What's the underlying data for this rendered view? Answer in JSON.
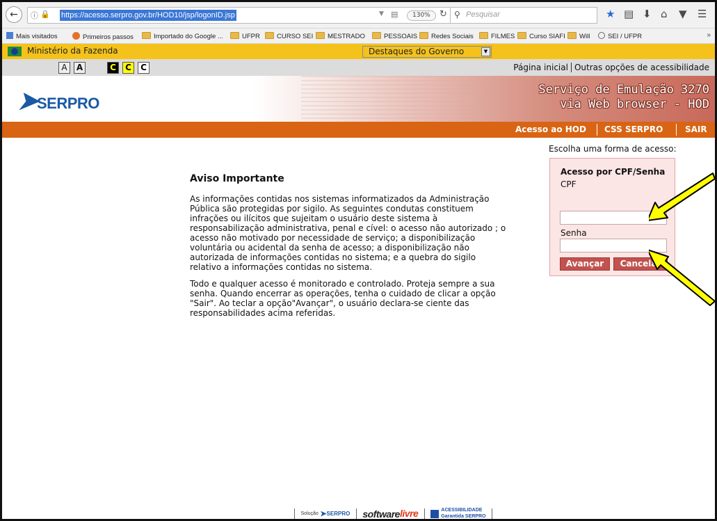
{
  "browser": {
    "url": "https://acesso.serpro.gov.br/HOD10/jsp/logonID.jsp",
    "zoom": "130%",
    "search_placeholder": "Pesquisar"
  },
  "bookmarks": [
    {
      "label": "Mais visitados",
      "icon": "mais-visitados-icon"
    },
    {
      "label": "Primeiros passos",
      "icon": "firefox-icon"
    },
    {
      "label": "Importado do Google ...",
      "icon": "folder-icon"
    },
    {
      "label": "UFPR",
      "icon": "folder-icon"
    },
    {
      "label": "CURSO SEI",
      "icon": "folder-icon"
    },
    {
      "label": "MESTRADO",
      "icon": "folder-icon"
    },
    {
      "label": "PESSOAIS",
      "icon": "folder-icon"
    },
    {
      "label": "Redes Sociais",
      "icon": "folder-icon"
    },
    {
      "label": "FILMES",
      "icon": "folder-icon"
    },
    {
      "label": "Curso SIAFI",
      "icon": "folder-icon"
    },
    {
      "label": "Will",
      "icon": "folder-icon"
    },
    {
      "label": "SEI / UFPR",
      "icon": "globe-icon"
    }
  ],
  "gov_bar": {
    "ministry": "Ministério da Fazenda",
    "select_value": "Destaques do Governo"
  },
  "accessibility": {
    "font_buttons": [
      "A",
      "A"
    ],
    "contrast_buttons": [
      "C",
      "C",
      "C"
    ],
    "home_link": "Página inicial",
    "other_options": "Outras opções de acessibilidade"
  },
  "header": {
    "logo_text": "SERPRO",
    "title_line1": "Serviço de Emulação 3270",
    "title_line2": "via Web browser - HOD"
  },
  "nav": {
    "hod": "Acesso ao HOD",
    "css": "CSS SERPRO",
    "exit": "SAIR"
  },
  "notice": {
    "title": "Aviso Importante",
    "paragraph1": "As informações contidas nos sistemas informatizados da Administração Pública são protegidas por sigilo. As seguintes condutas constituem infrações ou ilícitos que sujeitam o usuário deste sistema à responsabilização administrativa, penal e cível: o acesso não autorizado ; o acesso não motivado por necessidade de serviço; a disponibilização voluntária ou acidental da senha de acesso; a disponibilização não autorizada de informações contidas no sistema; e a quebra do sigilo relativo a informações contidas no sistema.",
    "paragraph2": "Todo e qualquer acesso é monitorado e controlado. Proteja sempre a sua senha. Quando encerrar as operações, tenha o cuidado de clicar a opção \"Sair\". Ao teclar a opção\"Avançar\", o usuário declara-se ciente das responsabilidades acima referidas."
  },
  "login": {
    "prompt": "Escolha uma forma de acesso:",
    "box_title": "Acesso por CPF/Senha",
    "cpf_label": "CPF",
    "cpf_value": "",
    "password_label": "Senha",
    "password_value": "",
    "submit": "Avançar",
    "cancel": "Cancelar"
  },
  "footer": {
    "solution_prefix": "Solução",
    "serpro": "SERPRO",
    "software_a": "software",
    "software_b": "livre",
    "acc_line1": "ACESSIBILIDADE",
    "acc_line2": "Garantida SERPRO"
  },
  "colors": {
    "gov_yellow": "#f4c21b",
    "nav_orange": "#d96413",
    "serpro_blue": "#1a5aa5",
    "login_bg": "#fbe5e5",
    "button_red": "#c1524e",
    "annotation_yellow": "#ffff00"
  }
}
